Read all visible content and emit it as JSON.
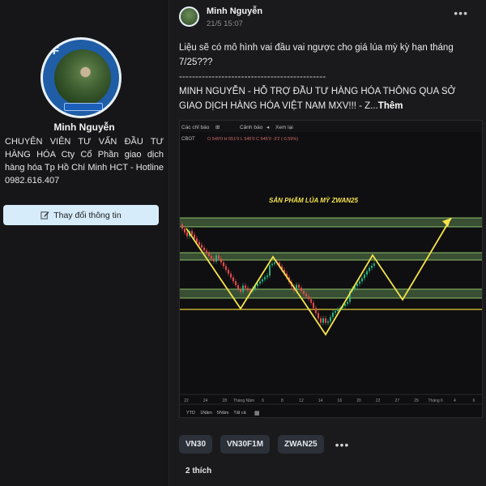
{
  "profile": {
    "name": "Minh Nguyễn",
    "bio": "CHUYÊN VIÊN TƯ VẤN ĐẦU TƯ HÀNG HÓA Cty Cổ Phần giao dịch hàng hóa Tp Hồ Chí Minh HCT - Hotline 0982.616.407",
    "edit_button_label": "Thay đổi thông tin",
    "edit_icon": "pencil-edit-icon"
  },
  "post": {
    "author": "Minh Nguyễn",
    "date": "21/5 15:07",
    "more_icon": "more-dots-icon",
    "text_line1": "Liệu sẽ có mô hình vai đầu vai ngược cho giá lúa mỳ kỳ hạn tháng 7/25???",
    "separator": "---------------------------------------------",
    "text_line2": "MINH NGUYỄN - HỖ TRỢ ĐẦU TƯ HÀNG HÓA THÔNG QUA SỞ GIAO DỊCH HÀNG HÓA VIỆT NAM MXV!!! - Z...",
    "see_more": "Thêm",
    "likes": "2 thích"
  },
  "chart": {
    "toolbar": {
      "indicators": "Các chỉ báo",
      "alert": "Cảnh báo",
      "replay": "Xem lại"
    },
    "symbol": "CBOT",
    "ohlc": "O 549'0  H 551'0  L 545'0  C 545'0  -3'2 (-0.59%)",
    "annotation": "SẢN PHẨM LÚA MỲ ZWAN25",
    "x_ticks": [
      "22",
      "24",
      "28",
      "Tháng Năm",
      "6",
      "8",
      "12",
      "14",
      "16",
      "20",
      "22",
      "27",
      "29",
      "Tháng 6",
      "4",
      "6"
    ],
    "ranges": [
      "YTD",
      "1Năm",
      "5Năm",
      "Tất cả"
    ],
    "calendar_icon": "calendar-icon",
    "colors": {
      "zone": "#3f5b3a",
      "zone_border": "#8fbf6a",
      "pattern": "#f5e34a",
      "neckline": "#e7cf3b",
      "candle_up": "#28b07e",
      "candle_down": "#e24b4b"
    }
  },
  "tags": [
    "VN30",
    "VN30F1M",
    "ZWAN25"
  ],
  "tags_more_icon": "more-dots-icon"
}
